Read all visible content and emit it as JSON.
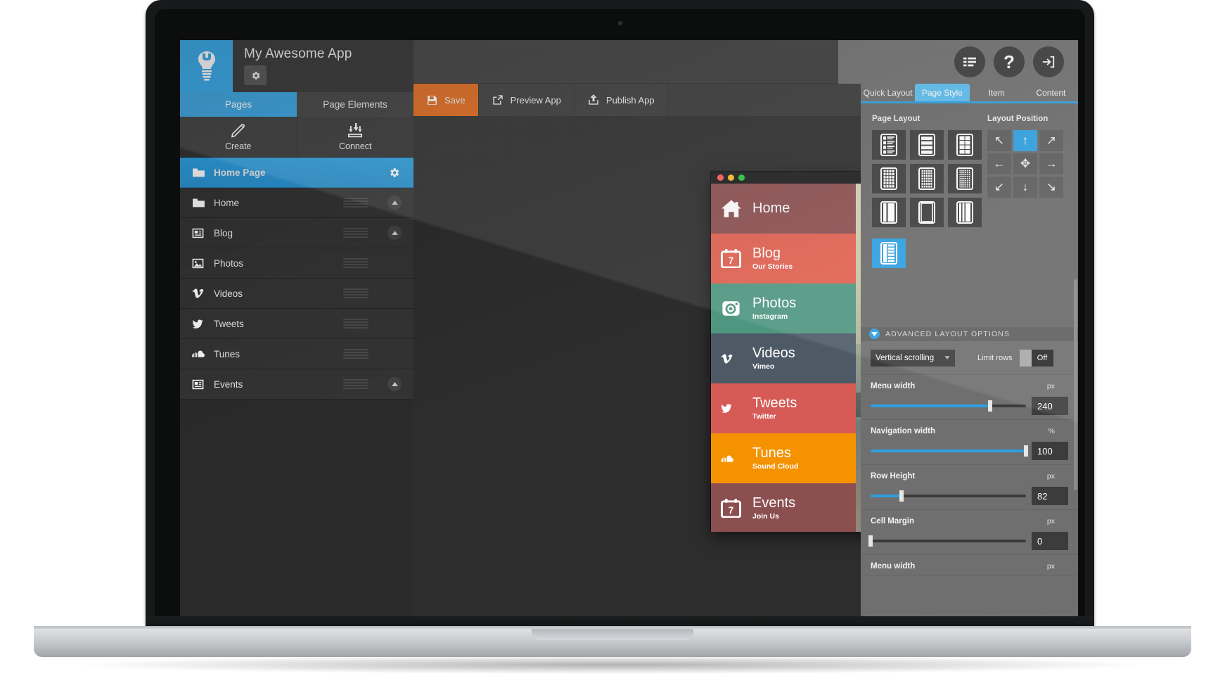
{
  "brand": {
    "title": "My Awesome App",
    "logo_icon": "wrench-bulb-icon",
    "settings_icon": "gear-icon"
  },
  "left_tabs": [
    {
      "label": "Pages",
      "active": true
    },
    {
      "label": "Page Elements",
      "active": false
    }
  ],
  "create_connect": [
    {
      "label": "Create",
      "icon": "pencil-icon"
    },
    {
      "label": "Connect",
      "icon": "download-arrows-icon"
    }
  ],
  "pages": [
    {
      "label": "Home Page",
      "icon": "folder-icon",
      "selected": true,
      "has_grip": false,
      "has_gear": true,
      "has_chevron": false
    },
    {
      "label": "Home",
      "icon": "folder-icon",
      "selected": false,
      "has_grip": true,
      "has_gear": false,
      "has_chevron": true
    },
    {
      "label": "Blog",
      "icon": "news-icon",
      "selected": false,
      "has_grip": true,
      "has_gear": false,
      "has_chevron": true
    },
    {
      "label": "Photos",
      "icon": "image-icon",
      "selected": false,
      "has_grip": true,
      "has_gear": false,
      "has_chevron": false
    },
    {
      "label": "Videos",
      "icon": "vimeo-icon",
      "selected": false,
      "has_grip": true,
      "has_gear": false,
      "has_chevron": false
    },
    {
      "label": "Tweets",
      "icon": "twitter-icon",
      "selected": false,
      "has_grip": true,
      "has_gear": false,
      "has_chevron": false
    },
    {
      "label": "Tunes",
      "icon": "soundcloud-icon",
      "selected": false,
      "has_grip": true,
      "has_gear": false,
      "has_chevron": false
    },
    {
      "label": "Events",
      "icon": "news-icon",
      "selected": false,
      "has_grip": true,
      "has_gear": false,
      "has_chevron": true
    }
  ],
  "toolbar": [
    {
      "label": "Save",
      "icon": "floppy-icon",
      "primary": true
    },
    {
      "label": "Preview App",
      "icon": "external-link-icon",
      "primary": false
    },
    {
      "label": "Publish App",
      "icon": "upload-box-icon",
      "primary": false
    }
  ],
  "zoom_tools": [
    {
      "icon": "zoom-in-icon",
      "active": false
    },
    {
      "icon": "zoom-out-icon",
      "active": false
    },
    {
      "icon": "device-pair-icon",
      "active": false
    },
    {
      "icon": "desktop-icon",
      "active": true
    },
    {
      "icon": "apple-icon",
      "active": false
    },
    {
      "icon": "android-icon",
      "active": false
    },
    {
      "icon": "tablet-icon",
      "active": false
    }
  ],
  "phone_preview": {
    "window_dots": [
      "#ff5f57",
      "#ffbd2e",
      "#28c840"
    ],
    "hamburger_icon": "hamburger-icon",
    "rows": [
      {
        "title": "Home",
        "sub": "",
        "icon": "house-icon",
        "color": "#8c4f50"
      },
      {
        "title": "Blog",
        "sub": "Our Stories",
        "icon": "calendar-icon",
        "color": "#e06050"
      },
      {
        "title": "Photos",
        "sub": "Instagram",
        "icon": "instagram-icon",
        "color": "#4e9680"
      },
      {
        "title": "Videos",
        "sub": "Vimeo",
        "icon": "vimeo-icon",
        "color": "#4d5a66"
      },
      {
        "title": "Tweets",
        "sub": "Twitter",
        "icon": "twitter-icon",
        "color": "#d65a55"
      },
      {
        "title": "Tunes",
        "sub": "Sound Cloud",
        "icon": "soundcloud-icon",
        "color": "#f59200"
      },
      {
        "title": "Events",
        "sub": "Join Us",
        "icon": "calendar-icon",
        "color": "#8c4f50"
      }
    ]
  },
  "right_header_buttons": [
    {
      "icon": "list-align-icon"
    },
    {
      "icon": "help-icon",
      "glyph": "?"
    },
    {
      "icon": "logout-icon"
    }
  ],
  "right_tabs": [
    {
      "label": "Quick Layout",
      "active": false
    },
    {
      "label": "Page Style",
      "active": true
    },
    {
      "label": "Item",
      "active": false
    },
    {
      "label": "Content",
      "active": false
    }
  ],
  "page_style": {
    "page_layout_label": "Page Layout",
    "layout_position_label": "Layout Position",
    "layout_cells": [
      {
        "icon": "list-detail-layout-icon",
        "selected": false
      },
      {
        "icon": "stacked-rows-layout-icon",
        "selected": false
      },
      {
        "icon": "two-col-grid-layout-icon",
        "selected": false
      },
      {
        "icon": "dense-grid-layout-icon",
        "selected": false
      },
      {
        "icon": "fine-grid-layout-icon",
        "selected": false
      },
      {
        "icon": "table-layout-icon",
        "selected": false
      },
      {
        "icon": "split-panel-layout-icon",
        "selected": false
      },
      {
        "icon": "single-panel-layout-icon",
        "selected": false
      },
      {
        "icon": "sidebar-layout-icon",
        "selected": false
      },
      {
        "icon": "menu-list-layout-icon",
        "selected": true
      }
    ],
    "position_cells": [
      {
        "icon": "arrow-up-left-icon",
        "glyph": "↖",
        "selected": false
      },
      {
        "icon": "arrow-up-icon",
        "glyph": "↑",
        "selected": true
      },
      {
        "icon": "arrow-up-right-icon",
        "glyph": "↗",
        "selected": false
      },
      {
        "icon": "arrow-left-icon",
        "glyph": "←",
        "selected": false
      },
      {
        "icon": "arrow-center-icon",
        "glyph": "✥",
        "selected": false
      },
      {
        "icon": "arrow-right-icon",
        "glyph": "→",
        "selected": false
      },
      {
        "icon": "arrow-down-left-icon",
        "glyph": "↙",
        "selected": false
      },
      {
        "icon": "arrow-down-icon",
        "glyph": "↓",
        "selected": false
      },
      {
        "icon": "arrow-down-right-icon",
        "glyph": "↘",
        "selected": false
      }
    ],
    "advanced_label": "ADVANCED LAYOUT OPTIONS",
    "advanced_toggle_icon": "chevron-down-icon",
    "scroll_select": {
      "value": "Vertical scrolling",
      "caret_icon": "caret-down-icon"
    },
    "limit_rows": {
      "label": "Limit rows",
      "state": "Off"
    },
    "sliders": [
      {
        "name": "Menu width",
        "unit": "px",
        "value": "240",
        "percent": 77
      },
      {
        "name": "Navigation width",
        "unit": "%",
        "value": "100",
        "percent": 100
      },
      {
        "name": "Row Height",
        "unit": "px",
        "value": "82",
        "percent": 20
      },
      {
        "name": "Cell Margin",
        "unit": "px",
        "value": "0",
        "percent": 0
      },
      {
        "name": "Menu width",
        "unit": "px",
        "value": "",
        "percent": 0
      }
    ]
  }
}
